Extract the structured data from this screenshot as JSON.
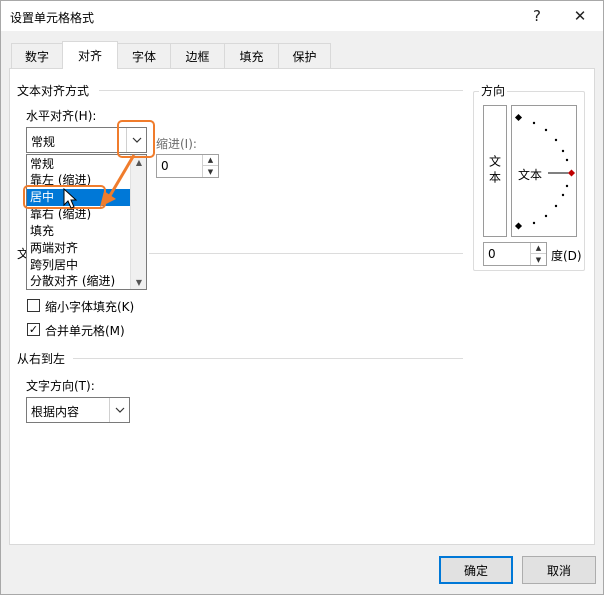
{
  "window": {
    "title": "设置单元格格式",
    "help_label": "?",
    "close_label": "✕"
  },
  "tabs": [
    {
      "label": "数字"
    },
    {
      "label": "对齐",
      "active": true
    },
    {
      "label": "字体"
    },
    {
      "label": "边框"
    },
    {
      "label": "填充"
    },
    {
      "label": "保护"
    }
  ],
  "alignment": {
    "section_title": "文本对齐方式",
    "horizontal_label": "水平对齐(H):",
    "horizontal_value": "常规",
    "indent_label": "缩进(I):",
    "indent_value": "0",
    "dropdown_options": [
      "常规",
      "靠左 (缩进)",
      "居中",
      "靠右 (缩进)",
      "填充",
      "两端对齐",
      "跨列居中",
      "分散对齐 (缩进)"
    ],
    "selected_option": "居中",
    "obscured_prefix": "文"
  },
  "text_control": {
    "shrink_label": "缩小字体填充(K)",
    "shrink_checked": false,
    "merge_label": "合并单元格(M)",
    "merge_checked": true
  },
  "rtl": {
    "section_title": "从右到左",
    "direction_label": "文字方向(T):",
    "direction_value": "根据内容"
  },
  "orientation": {
    "title": "方向",
    "vertical_text": "文本",
    "dial_text": "文本",
    "degree_value": "0",
    "degree_label": "度(D)"
  },
  "buttons": {
    "ok_label": "确定",
    "cancel_label": "取消"
  },
  "colors": {
    "accent": "#0078d7",
    "highlight": "#f07c2c"
  }
}
